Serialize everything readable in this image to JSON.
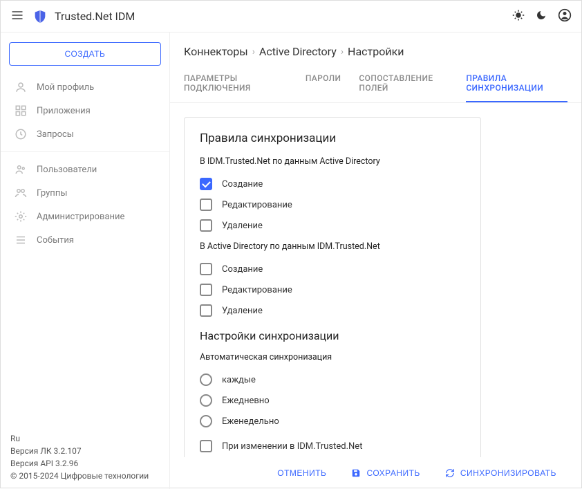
{
  "app": {
    "title": "Trusted.Net IDM"
  },
  "sidebar": {
    "create_label": "СОЗДАТЬ",
    "group1": [
      {
        "label": "Мой профиль"
      },
      {
        "label": "Приложения"
      },
      {
        "label": "Запросы"
      }
    ],
    "group2": [
      {
        "label": "Пользователи"
      },
      {
        "label": "Группы"
      },
      {
        "label": "Администрирование"
      },
      {
        "label": "События"
      }
    ],
    "footer": {
      "lang": "Ru",
      "ver_lk": "Версия ЛК 3.2.107",
      "ver_api": "Версия API 3.2.96",
      "copyright": "© 2015-2024 Цифровые технологии"
    }
  },
  "breadcrumb": {
    "a": "Коннекторы",
    "b": "Active Directory",
    "c": "Настройки"
  },
  "tabs": [
    {
      "label": "ПАРАМЕТРЫ ПОДКЛЮЧЕНИЯ",
      "active": false
    },
    {
      "label": "ПАРОЛИ",
      "active": false
    },
    {
      "label": "СОПОСТАВЛЕНИЕ ПОЛЕЙ",
      "active": false
    },
    {
      "label": "ПРАВИЛА СИНХРОНИЗАЦИИ",
      "active": true
    }
  ],
  "card": {
    "title": "Правила синхронизации",
    "section1_sub": "В IDM.Trusted.Net по данным Active Directory",
    "section1_items": [
      {
        "label": "Создание",
        "checked": true
      },
      {
        "label": "Редактирование",
        "checked": false
      },
      {
        "label": "Удаление",
        "checked": false
      }
    ],
    "section2_sub": "В Active Directory по данным IDM.Trusted.Net",
    "section2_items": [
      {
        "label": "Создание",
        "checked": false
      },
      {
        "label": "Редактирование",
        "checked": false
      },
      {
        "label": "Удаление",
        "checked": false
      }
    ],
    "settings_title": "Настройки синхронизации",
    "settings_sub": "Автоматическая синхронизация",
    "radios": [
      {
        "label": "каждые"
      },
      {
        "label": "Ежедневно"
      },
      {
        "label": "Еженедельно"
      }
    ],
    "on_change": {
      "label": "При изменении в IDM.Trusted.Net",
      "checked": false
    }
  },
  "actions": {
    "cancel": "ОТМЕНИТЬ",
    "save": "СОХРАНИТЬ",
    "sync": "СИНХРОНИЗИРОВАТЬ"
  }
}
